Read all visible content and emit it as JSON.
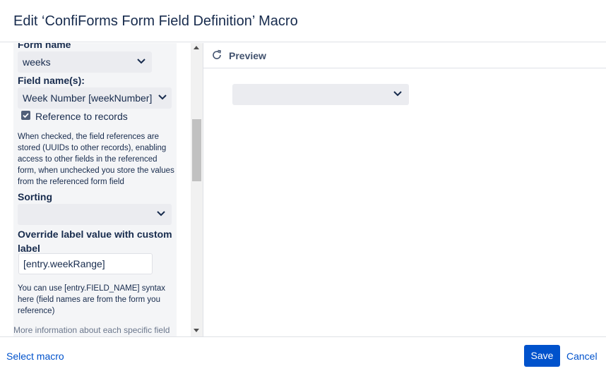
{
  "dialog": {
    "title": "Edit ‘ConfiForms Form Field Definition’ Macro"
  },
  "params": {
    "form_name": {
      "label": "Form name",
      "value": "weeks"
    },
    "field_names": {
      "label": "Field name(s):",
      "value": "Week Number [weekNumber]"
    },
    "reference_to_records": {
      "label": "Reference to records",
      "checked": true,
      "help": "When checked, the field references are stored (UUIDs to other records), enabling access to other fields in the referenced form, when unchecked you store the values from the referenced form field"
    },
    "sorting": {
      "label": "Sorting",
      "value": ""
    },
    "override_label": {
      "label": "Override label value with custom label",
      "value": "[entry.weekRange]",
      "help": "You can use [entry.FIELD_NAME] syntax here (field names are from the form you reference)"
    },
    "more_info": "More information about each specific field"
  },
  "preview": {
    "title": "Preview",
    "select_value": ""
  },
  "footer": {
    "select_macro": "Select macro",
    "save": "Save",
    "cancel": "Cancel"
  },
  "colors": {
    "primary": "#0052cc",
    "text": "#172b4d",
    "field_bg": "#ebecf0",
    "panel_bg": "#f4f5f7",
    "border": "#dfe1e6"
  },
  "icons": {
    "refresh": "refresh-icon",
    "dropdown": "chevron-down-icon",
    "checkbox": "checkbox-checked-icon"
  }
}
